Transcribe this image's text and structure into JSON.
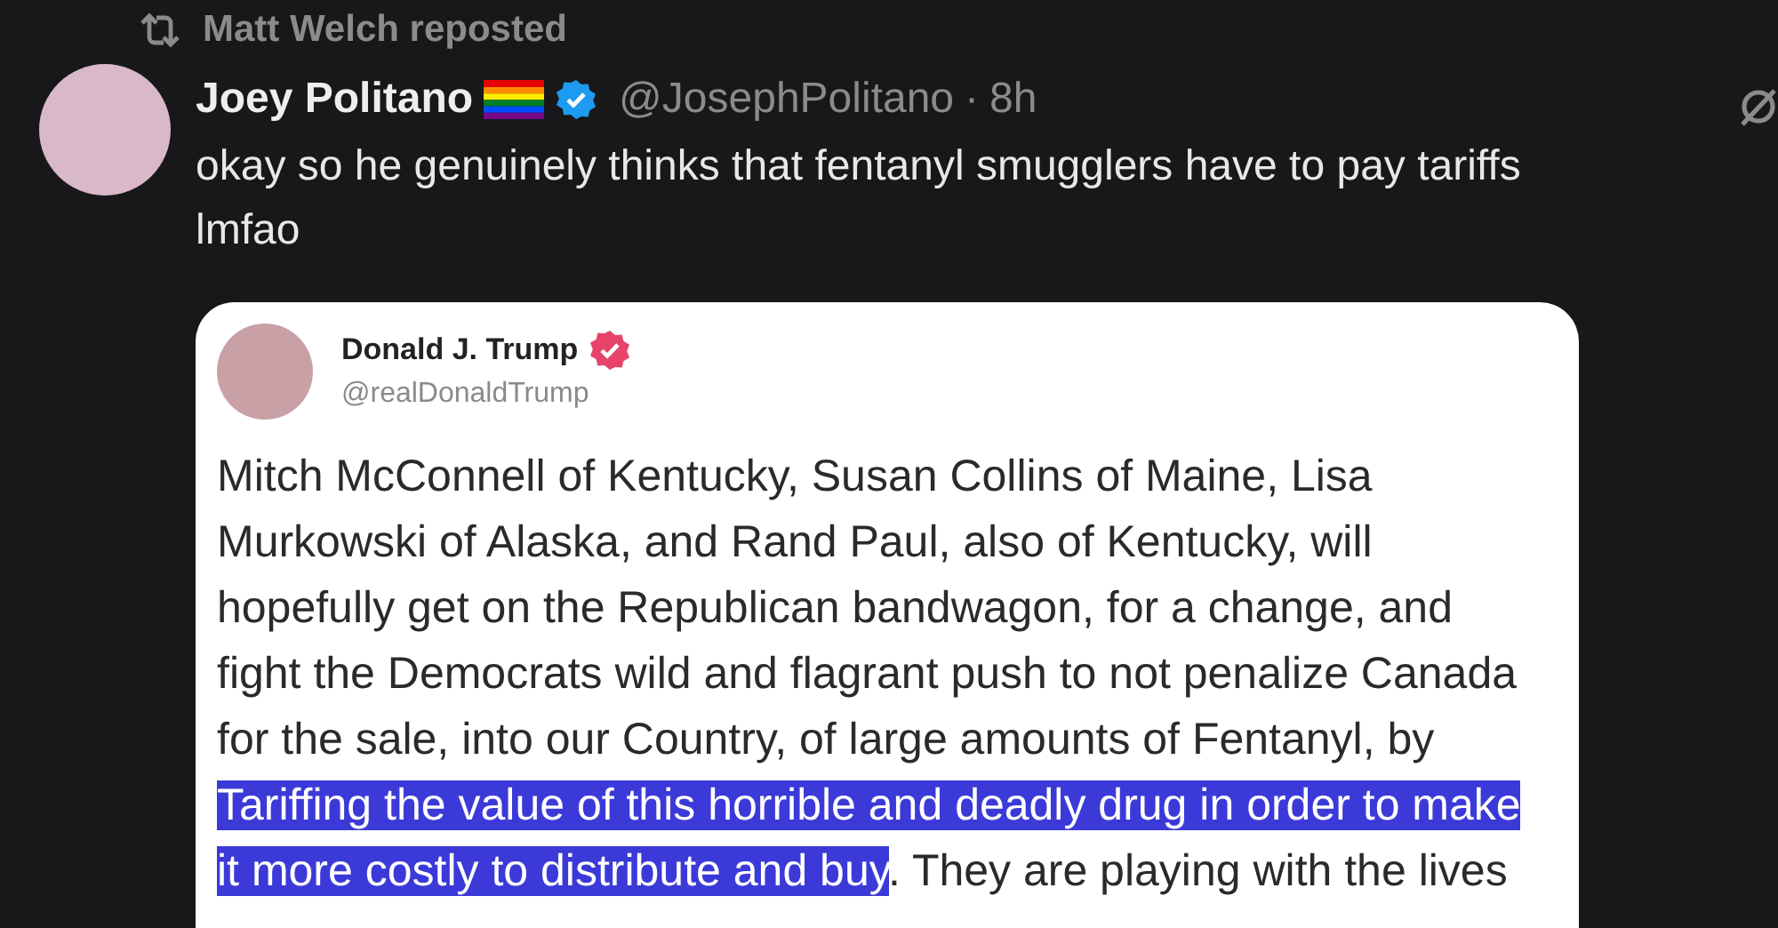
{
  "repost": {
    "label": "Matt Welch reposted"
  },
  "tweet": {
    "name": "Joey Politano",
    "verified": true,
    "handle": "@JosephPolitano",
    "separator": "·",
    "time": "8h",
    "text": "okay so he genuinely thinks that fentanyl smugglers have to pay tariffs lmfao"
  },
  "embedded_post": {
    "name": "Donald J. Trump",
    "verified": true,
    "handle": "@realDonaldTrump",
    "lines": [
      [
        {
          "text": "Mitch McConnell of Kentucky, Susan Collins of Maine, Lisa",
          "highlighted": false
        }
      ],
      [
        {
          "text": "Murkowski of Alaska, and Rand Paul, also of Kentucky, will",
          "highlighted": false
        }
      ],
      [
        {
          "text": "hopefully get on the Republican bandwagon, for a change, and",
          "highlighted": false
        }
      ],
      [
        {
          "text": "fight the Democrats wild and flagrant push to not penalize Canada",
          "highlighted": false
        }
      ],
      [
        {
          "text": "for the sale, into our Country, of large amounts of Fentanyl, by",
          "highlighted": false
        }
      ],
      [
        {
          "text": "Tariffing the value of this horrible and deadly drug in order to make",
          "highlighted": true
        }
      ],
      [
        {
          "text": "it more costly to distribute and buy",
          "highlighted": true
        },
        {
          "text": ". They are playing with the lives",
          "highlighted": false
        }
      ]
    ]
  }
}
